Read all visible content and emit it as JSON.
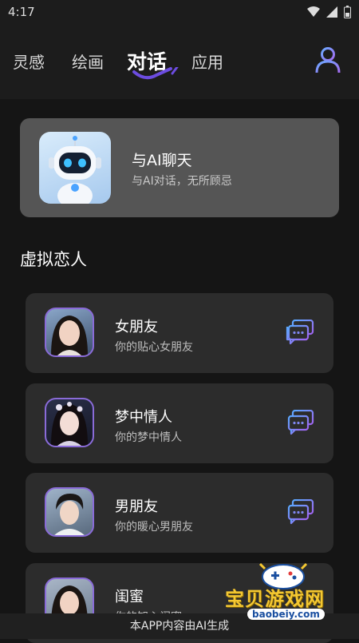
{
  "status_bar": {
    "time": "4:17"
  },
  "header": {
    "tabs": [
      {
        "label": "灵感"
      },
      {
        "label": "绘画"
      },
      {
        "label": "对话"
      },
      {
        "label": "应用"
      }
    ],
    "active_tab": "对话",
    "accent_color": "#6c4ce0",
    "user_icon": "user-profile-icon"
  },
  "ai_card": {
    "title": "与AI聊天",
    "subtitle": "与AI对话，无所顾忌",
    "icon": "robot-avatar"
  },
  "section": {
    "title": "虚拟恋人"
  },
  "items": [
    {
      "title": "女朋友",
      "subtitle": "你的贴心女朋友",
      "icon": "chat-bubbles-icon"
    },
    {
      "title": "梦中情人",
      "subtitle": "你的梦中情人",
      "icon": "chat-bubbles-icon"
    },
    {
      "title": "男朋友",
      "subtitle": "你的暖心男朋友",
      "icon": "chat-bubbles-icon"
    },
    {
      "title": "闺蜜",
      "subtitle": "你的知心闺蜜",
      "icon": "chat-bubbles-icon"
    }
  ],
  "footer": {
    "text": "本APP内容由AI生成"
  },
  "watermark": {
    "text": "宝贝游戏网",
    "url": "baobeiy.com"
  }
}
